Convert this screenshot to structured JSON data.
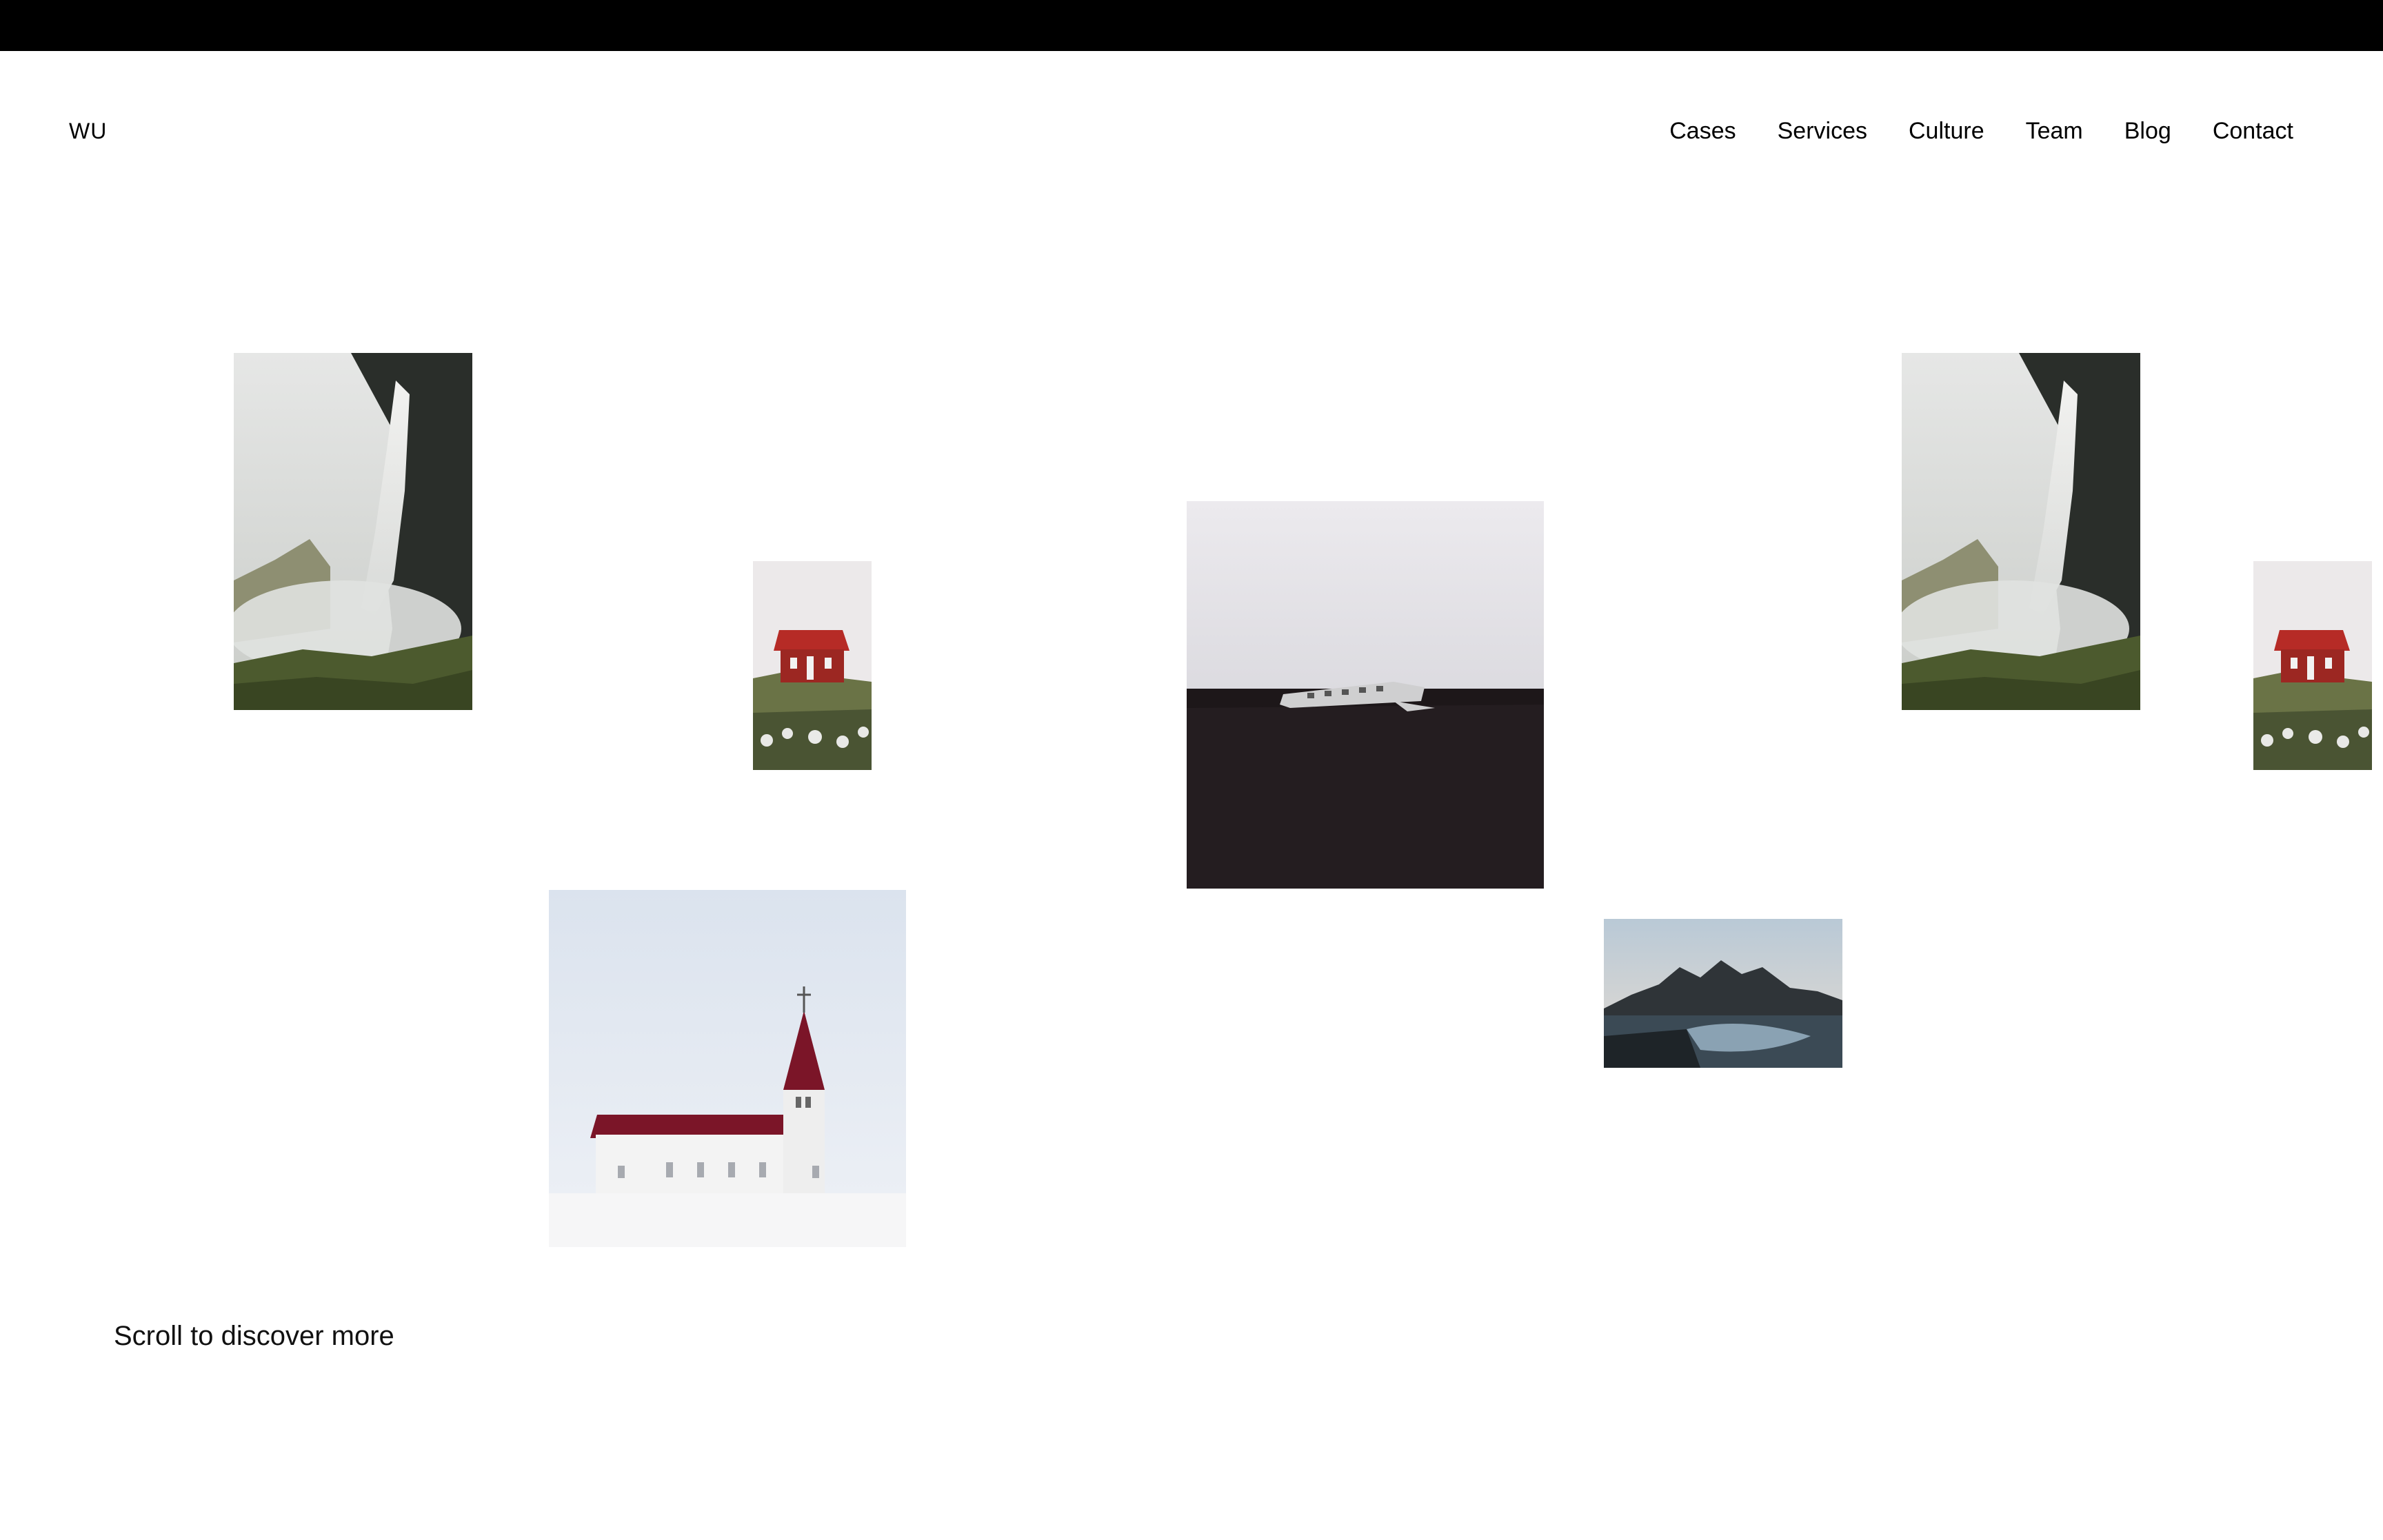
{
  "header": {
    "logo": "WU",
    "nav": [
      "Cases",
      "Services",
      "Culture",
      "Team",
      "Blog",
      "Contact"
    ]
  },
  "gallery": [
    {
      "id": "waterfall-1",
      "subject": "waterfall"
    },
    {
      "id": "redhouse-1",
      "subject": "red house on hill"
    },
    {
      "id": "plane",
      "subject": "plane wreck on black sand"
    },
    {
      "id": "church",
      "subject": "white church with red roof"
    },
    {
      "id": "coast",
      "subject": "mountain coastline"
    },
    {
      "id": "waterfall-2",
      "subject": "waterfall"
    },
    {
      "id": "redhouse-2",
      "subject": "red house on hill"
    }
  ],
  "footer": {
    "scroll_hint": "Scroll to discover more"
  },
  "colors": {
    "topbar": "#000000",
    "background": "#ffffff",
    "text": "#000000"
  }
}
